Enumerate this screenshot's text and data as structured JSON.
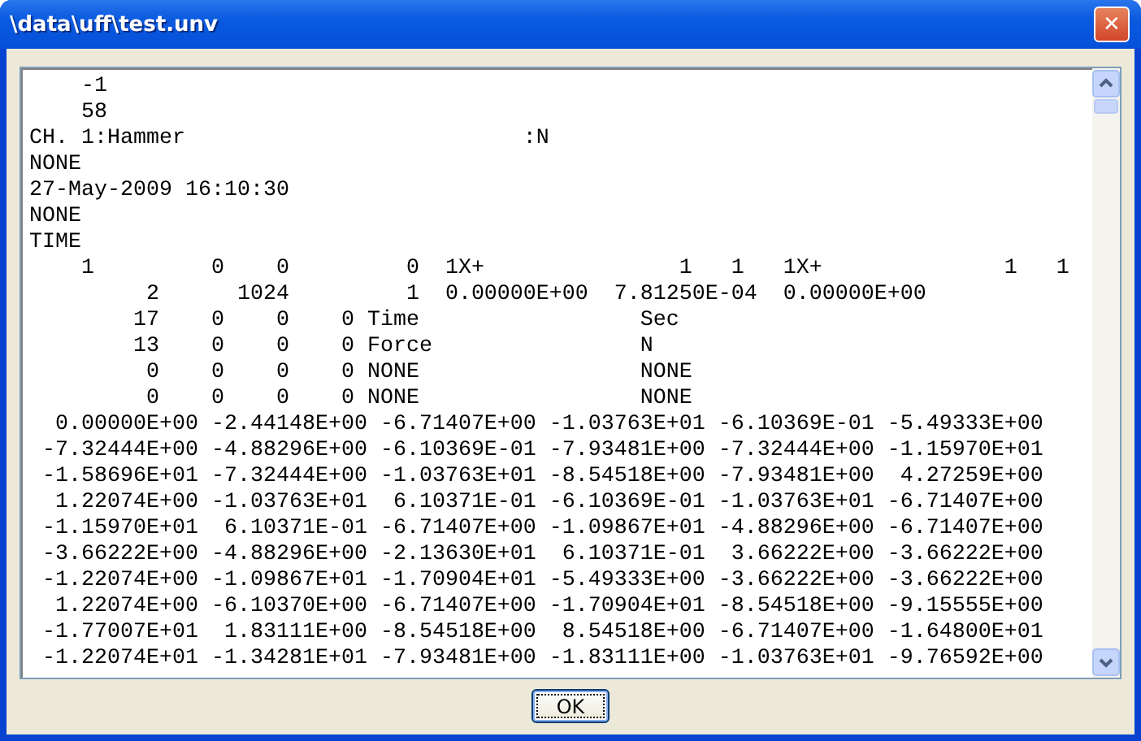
{
  "window": {
    "title": "\\data\\uff\\test.unv",
    "close_glyph": "✕"
  },
  "text_view": {
    "lines": [
      "    -1",
      "    58",
      "CH. 1:Hammer                          :N",
      "NONE",
      "27-May-2009 16:10:30",
      "NONE",
      "TIME",
      "    1         0    0         0  1X+               1   1   1X+              1   1",
      "         2      1024         1  0.00000E+00  7.81250E-04  0.00000E+00",
      "        17    0    0    0 Time                 Sec",
      "        13    0    0    0 Force                N",
      "         0    0    0    0 NONE                 NONE",
      "         0    0    0    0 NONE                 NONE",
      "  0.00000E+00 -2.44148E+00 -6.71407E+00 -1.03763E+01 -6.10369E-01 -5.49333E+00",
      " -7.32444E+00 -4.88296E+00 -6.10369E-01 -7.93481E+00 -7.32444E+00 -1.15970E+01",
      " -1.58696E+01 -7.32444E+00 -1.03763E+01 -8.54518E+00 -7.93481E+00  4.27259E+00",
      "  1.22074E+00 -1.03763E+01  6.10371E-01 -6.10369E-01 -1.03763E+01 -6.71407E+00",
      " -1.15970E+01  6.10371E-01 -6.71407E+00 -1.09867E+01 -4.88296E+00 -6.71407E+00",
      " -3.66222E+00 -4.88296E+00 -2.13630E+01  6.10371E-01  3.66222E+00 -3.66222E+00",
      " -1.22074E+00 -1.09867E+01 -1.70904E+01 -5.49333E+00 -3.66222E+00 -3.66222E+00",
      "  1.22074E+00 -6.10370E+00 -6.71407E+00 -1.70904E+01 -8.54518E+00 -9.15555E+00",
      " -1.77007E+01  1.83111E+00 -8.54518E+00  8.54518E+00 -6.71407E+00 -1.64800E+01",
      " -1.22074E+01 -1.34281E+01 -7.93481E+00 -1.83111E+00 -1.03763E+01 -9.76592E+00"
    ]
  },
  "buttons": [
    {
      "label": "OK",
      "selected": true
    }
  ]
}
